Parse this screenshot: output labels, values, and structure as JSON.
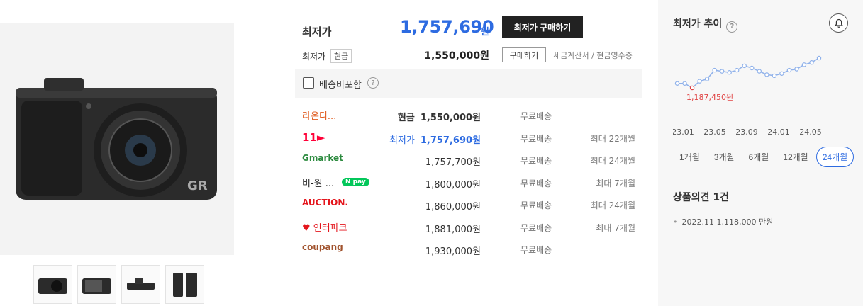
{
  "gallery": {
    "thumbnails": [
      "front-view",
      "back-view",
      "top-view",
      "side-view"
    ]
  },
  "price": {
    "lowest_label": "최저가",
    "lowest_value": "1,757,690",
    "won": "원",
    "buy_button": "최저가 구매하기",
    "cash_label": "최저가",
    "cash_tag": "현금",
    "cash_value": "1,550,000원",
    "buy_small": "구매하기",
    "receipt_text": "세금계산서 / 현금영수증",
    "shipping_filter_label": "배송비포함",
    "help": "?"
  },
  "offers": [
    {
      "mall": "라온디...",
      "mall_color": "#e05a1d",
      "prefix": "현금",
      "price": "1,550,000원",
      "style": "bold",
      "ship": "무료배송",
      "installment": ""
    },
    {
      "mall": "11►",
      "mall_color": "#ff0038",
      "prefix": "최저가",
      "price": "1,757,690원",
      "style": "blue",
      "ship": "무료배송",
      "installment": "최대 22개월"
    },
    {
      "mall": "Gmarket",
      "mall_color": "#2b8a3e",
      "prefix": "",
      "price": "1,757,700원",
      "style": "",
      "ship": "무료배송",
      "installment": "최대 24개월"
    },
    {
      "mall": "비-원 ...",
      "mall_color": "#222222",
      "prefix": "",
      "price": "1,800,000원",
      "style": "",
      "ship": "무료배송",
      "installment": "최대 7개월",
      "badge": "N pay"
    },
    {
      "mall": "AUCTION.",
      "mall_color": "#e4161d",
      "prefix": "",
      "price": "1,860,000원",
      "style": "",
      "ship": "무료배송",
      "installment": "최대 24개월"
    },
    {
      "mall": "♥ 인터파크",
      "mall_color": "#e4161d",
      "prefix": "",
      "price": "1,881,000원",
      "style": "",
      "ship": "무료배송",
      "installment": "최대 7개월"
    },
    {
      "mall": "coupang",
      "mall_color": "#a0522d",
      "prefix": "",
      "price": "1,930,000원",
      "style": "",
      "ship": "무료배송",
      "installment": ""
    }
  ],
  "trend": {
    "title": "최저가 추이",
    "help": "?",
    "min_label": "1,187,450원",
    "x_ticks": [
      "23.01",
      "23.05",
      "23.09",
      "24.01",
      "24.05"
    ],
    "series": [
      1.23,
      1.23,
      1.19,
      1.25,
      1.27,
      1.35,
      1.34,
      1.33,
      1.35,
      1.39,
      1.37,
      1.34,
      1.31,
      1.3,
      1.32,
      1.35,
      1.36,
      1.4,
      1.42,
      1.46
    ],
    "min_index": 2,
    "periods": [
      "1개월",
      "3개월",
      "6개월",
      "12개월",
      "24개월"
    ],
    "active_period": "24개월"
  },
  "reviews": {
    "title": "상품의견 1건",
    "items": [
      "2022.11 1,118,000 만원"
    ]
  },
  "colors": {
    "accent": "#2d6be1",
    "dark": "#222222",
    "line": "#8fb1ea",
    "min_point": "#e04343"
  }
}
